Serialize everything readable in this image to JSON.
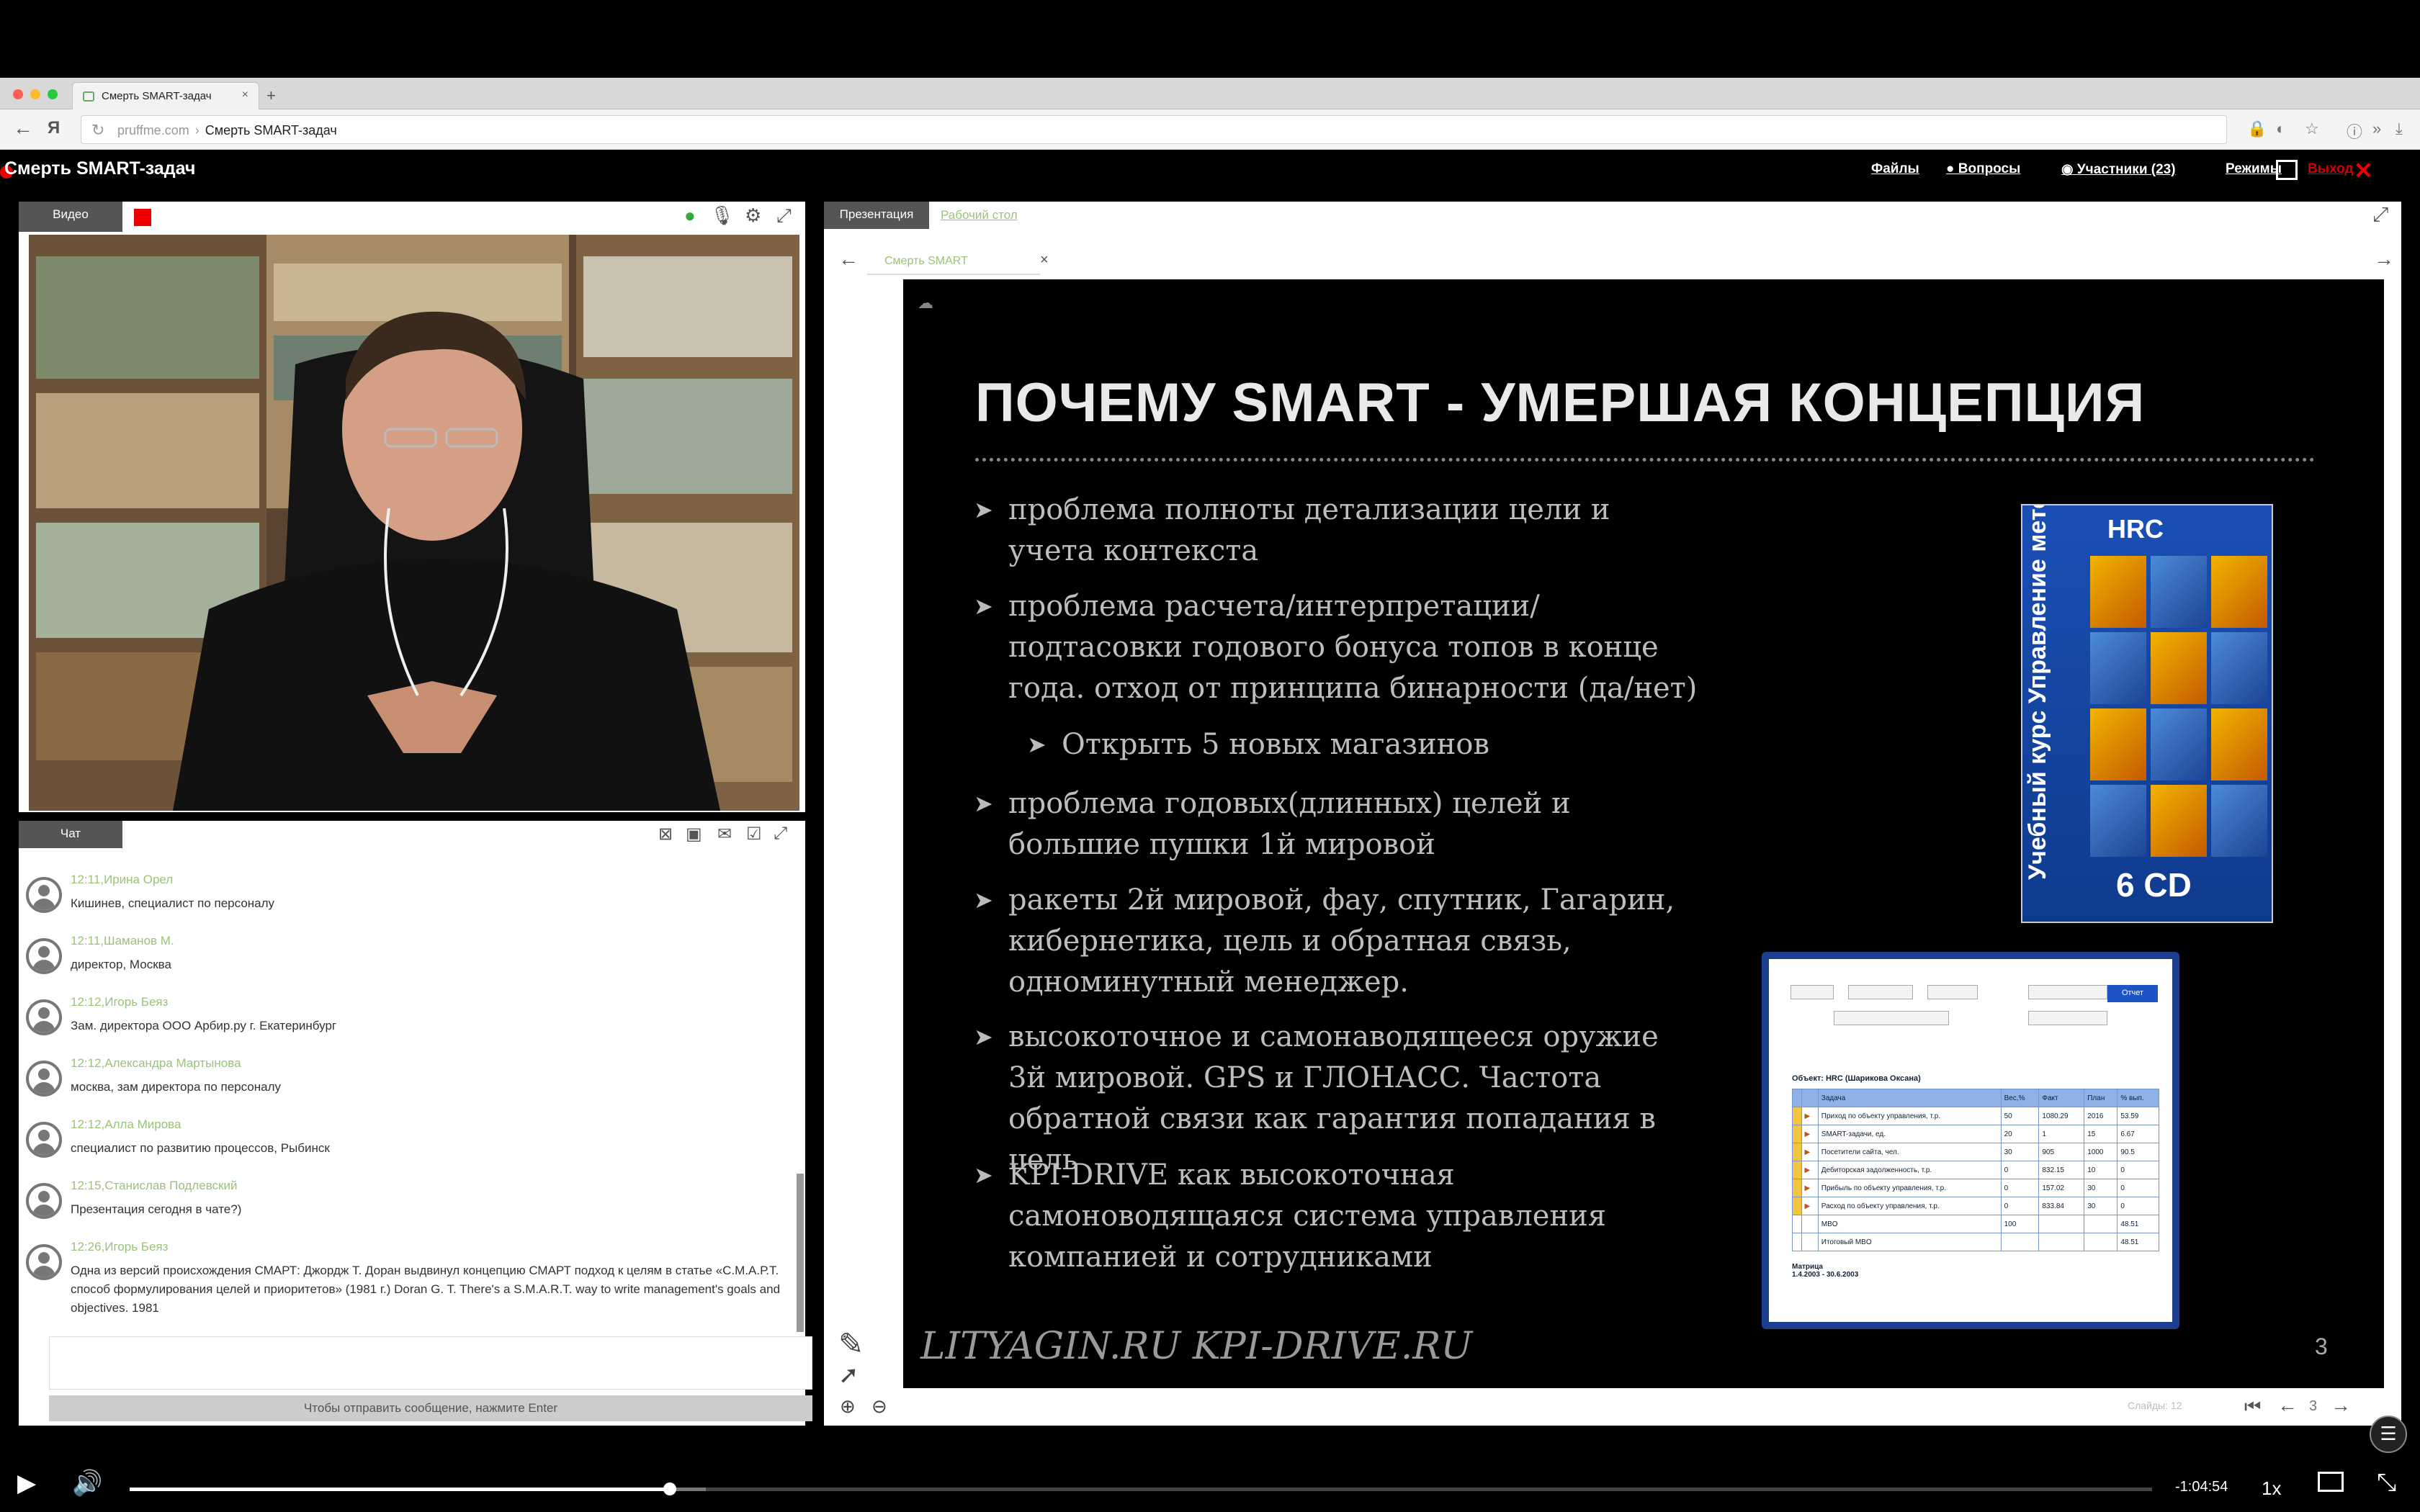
{
  "browser": {
    "tab_title": "Смерть SMART-задач",
    "tab_close": "×",
    "new_tab": "+",
    "url_domain": "pruffme.com",
    "url_separator": "›",
    "url_page": "Смерть SMART-задач"
  },
  "app": {
    "title": "Смерть SMART-задач",
    "menu": {
      "files": "Файлы",
      "questions": "Вопросы",
      "participants": "Участники (23)",
      "modes": "Режимы",
      "exit": "Выход"
    }
  },
  "video": {
    "tab_label": "Видео"
  },
  "chat": {
    "tab_label": "Чат",
    "send_hint": "Чтобы отправить сообщение, нажмите Enter",
    "messages": [
      {
        "meta": "12:11,Ирина Орел",
        "text": "Кишинев, специалист по персоналу"
      },
      {
        "meta": "12:11,Шаманов М.",
        "text": "директор, Москва"
      },
      {
        "meta": "12:12,Игорь Беяз",
        "text": "Зам. директора ООО Арбир.ру г. Екатеринбург"
      },
      {
        "meta": "12:12,Александра Мартынова",
        "text": "москва, зам директора по персоналу"
      },
      {
        "meta": "12:12,Алла Мирова",
        "text": "специалист по развитию процессов, Рыбинск"
      },
      {
        "meta": "12:15,Станислав Подлевский",
        "text": "Презентация сегодня в чате?)"
      },
      {
        "meta": "12:26,Игорь Беяз",
        "text": "Одна из версий происхождения СМАРТ: Джордж Т. Доран выдвинул концепцию СМАРТ подход к целям в статье «С.М.А.Р.Т. способ формулирования целей и приоритетов» (1981 г.) Doran G. T. There's a S.M.A.R.T. way to write management's goals and objectives. 1981"
      }
    ]
  },
  "presentation": {
    "tab_label": "Презентация",
    "tab_desktop": "Рабочий стол",
    "file_tab": "Смерть SMART",
    "file_close": "×",
    "nav_prev": "←",
    "nav_next": "→",
    "slides_label": "Слайды",
    "slides_total": "12",
    "current_page": "3",
    "slide": {
      "title": "ПОЧЕМУ SMART - УМЕРШАЯ КОНЦЕПЦИЯ",
      "bullets": [
        "проблема полноты детализации цели и учета контекста",
        "проблема расчета/интерпретации/подтасовки годового бонуса топов в конце года. отход от принципа бинарности (да/нет)",
        "Открыть 5 новых магазинов",
        "проблема годовых(длинных) целей и большие пушки 1й мировой",
        "ракеты 2й мировой, фау, спутник, Гагарин, кибернетика, цель и обратная связь, одноминутный менеджер.",
        "высокоточное и самонаводящееся оружие 3й мировой. GPS и ГЛОНАСС. Частота обратной связи как гарантия попадания в цель",
        "KPI-DRIVE как высокоточная самоноводящаяся система управления компанией и сотрудниками"
      ],
      "footer": "LITYAGIN.RU  KPI-DRIVE.RU",
      "number": "3",
      "product_box": {
        "brand": "HRC",
        "vertical_text": "Учебный курс Управление методом MBO",
        "cd_label": "6 CD"
      },
      "mbo_screenshot": {
        "button": "Отчет",
        "caption": "Объект: HRC (Шарикова Оксана)",
        "headers": [
          "",
          "",
          "Задача",
          "Вес,%",
          "Факт",
          "План",
          "% вып."
        ],
        "rows": [
          [
            "",
            "▶",
            "Приход по объекту управления, т.р.",
            "50",
            "1080.29",
            "2016",
            "53.59"
          ],
          [
            "",
            "▶",
            "SMART-задачи, ед.",
            "20",
            "1",
            "15",
            "6.67"
          ],
          [
            "",
            "▶",
            "Посетители сайта, чел.",
            "30",
            "905",
            "1000",
            "90.5"
          ],
          [
            "",
            "▶",
            "Дебиторская задолженность, т.р.",
            "0",
            "832.15",
            "10",
            "0"
          ],
          [
            "",
            "▶",
            "Прибыль по объекту управления, т.р.",
            "0",
            "157.02",
            "30",
            "0"
          ],
          [
            "",
            "▶",
            "Расход по объекту управления, т.р.",
            "0",
            "833.84",
            "30",
            "0"
          ],
          [
            "",
            "",
            "MBO",
            "100",
            "",
            "",
            "48.51"
          ],
          [
            "",
            "",
            "Итоговый MBO",
            "",
            "",
            "",
            "48.51"
          ]
        ],
        "matrix_label": "Матрица",
        "period": "1.4.2003 - 30.6.2003"
      }
    }
  },
  "player": {
    "time_remaining": "-1:04:54",
    "speed": "1x",
    "progress": 0.267,
    "buffered": 0.285
  }
}
